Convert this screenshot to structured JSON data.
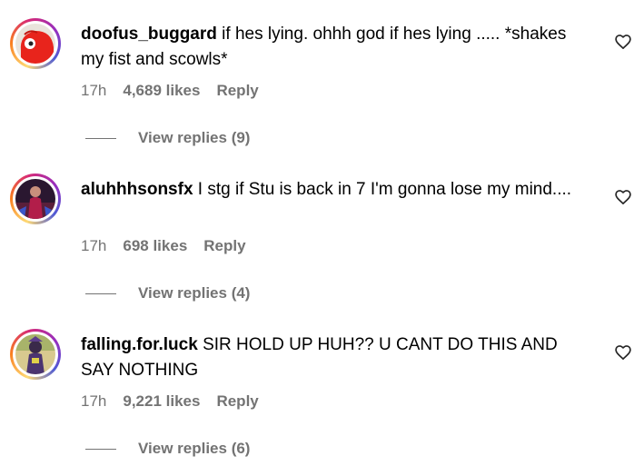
{
  "comments": [
    {
      "username": "doofus_buggard",
      "text": "if hes lying. ohhh god if hes lying ..... *shakes my fist and scowls*",
      "time": "17h",
      "likes": "4,689 likes",
      "reply": "Reply",
      "view_replies": "View replies (9)",
      "avatar_icon": "red-cartoon-avatar"
    },
    {
      "username": "aluhhhsonsfx",
      "text": "I stg if Stu is back in 7 I'm gonna lose my mind....",
      "time": "17h",
      "likes": "698 likes",
      "reply": "Reply",
      "view_replies": "View replies (4)",
      "avatar_icon": "performer-photo-avatar"
    },
    {
      "username": "falling.for.luck",
      "text": "SIR HOLD UP HUH?? U CANT DO THIS AND SAY NOTHING",
      "time": "17h",
      "likes": "9,221 likes",
      "reply": "Reply",
      "view_replies": "View replies (6)",
      "avatar_icon": "character-photo-avatar"
    }
  ],
  "colors": {
    "meta": "#737373",
    "text": "#000000",
    "story_ring": [
      "#feda75",
      "#fa7e1e",
      "#d62976",
      "#962fbf",
      "#4f5bd5"
    ]
  }
}
